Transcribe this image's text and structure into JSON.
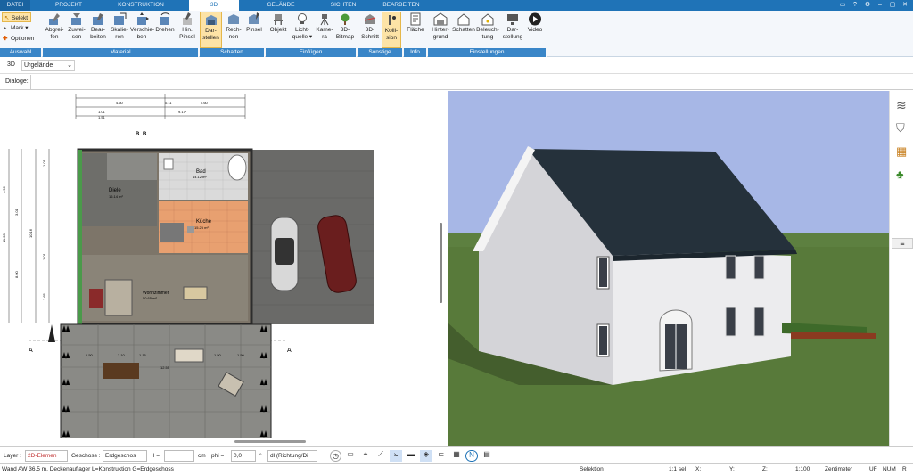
{
  "menu": {
    "tabs": [
      {
        "label": "DATEI"
      },
      {
        "label": "PROJEKT"
      },
      {
        "label": "KONSTRUKTION"
      },
      {
        "label": "3D"
      },
      {
        "label": "GELÄNDE"
      },
      {
        "label": "SICHTEN"
      },
      {
        "label": "BEARBEITEN"
      }
    ]
  },
  "ribbon": {
    "auswahl": {
      "selekt": "Selekt",
      "mark": "Mark",
      "optionen": "Optionen",
      "group": "Auswahl"
    },
    "material": {
      "buttons": [
        {
          "line1": "Abgrei-",
          "line2": "fen"
        },
        {
          "line1": "Zuwei-",
          "line2": "sen"
        },
        {
          "line1": "Bear-",
          "line2": "beiten"
        },
        {
          "line1": "Skalie-",
          "line2": "ren"
        },
        {
          "line1": "Verschie-",
          "line2": "ben"
        },
        {
          "line1": "Drehen",
          "line2": ""
        },
        {
          "line1": "Hin.",
          "line2": "Pinsel"
        }
      ],
      "group": "Material"
    },
    "schatten": {
      "buttons": [
        {
          "line1": "Dar-",
          "line2": "stellen"
        },
        {
          "line1": "Rech-",
          "line2": "nen"
        },
        {
          "line1": "Pinsel",
          "line2": ""
        }
      ],
      "group": "Schatten"
    },
    "einfuegen": {
      "buttons": [
        {
          "line1": "Objekt",
          "line2": ""
        },
        {
          "line1": "Licht-",
          "line2": "quelle ▾"
        },
        {
          "line1": "Kame-",
          "line2": "ra"
        },
        {
          "line1": "3D-",
          "line2": "Bitmap"
        }
      ],
      "group": "Einfügen"
    },
    "sonstige": {
      "buttons": [
        {
          "line1": "3D-",
          "line2": "Schnitt"
        },
        {
          "line1": "Kolli-",
          "line2": "sion"
        }
      ],
      "group": "Sonstige"
    },
    "info": {
      "buttons": [
        {
          "line1": "Fläche",
          "line2": ""
        }
      ],
      "group": "Info"
    },
    "einstellungen": {
      "buttons": [
        {
          "line1": "Hinter-",
          "line2": "grund"
        },
        {
          "line1": "Schatten",
          "line2": ""
        },
        {
          "line1": "Beleuch-",
          "line2": "tung"
        },
        {
          "line1": "Dar-",
          "line2": "stellung"
        },
        {
          "line1": "Video",
          "line2": ""
        }
      ],
      "group": "Einstellungen"
    }
  },
  "bar2": {
    "mode": "3D",
    "terrain": "Urgelände"
  },
  "bar3": {
    "dialoge": "Dialoge:"
  },
  "plan": {
    "dims_top": [
      "4.60",
      "0.11",
      "5.60",
      "1.01",
      "1.51",
      "9.17²"
    ],
    "dims_left": [
      "4.96",
      "3.01",
      "11.03",
      "10.16",
      "8.00",
      "1.01",
      "1.01",
      "1.65"
    ],
    "rooms": [
      {
        "name": "Diele",
        "area": "16.14 m²"
      },
      {
        "name": "Bad",
        "area": "14.12 m²"
      },
      {
        "name": "Küche",
        "area": "15.25 m²"
      },
      {
        "name": "Wohnzimmer",
        "area": "50.65 m²"
      }
    ],
    "terrace_dims": [
      "1.50",
      "2.10",
      "1.16",
      "12.55",
      "1.50",
      "1.50"
    ],
    "section_labels": [
      "A",
      "A",
      "B",
      "B"
    ]
  },
  "colors": {
    "accent": "#1f73b7",
    "ribbon_group": "#3a86c8",
    "selected": "#fde3a6",
    "sky": "#a7b7e6",
    "grass": "#587a3a",
    "roof": "#25313b"
  },
  "bottom_toolbar": {
    "layer_label": "Layer :",
    "layer_value": "2D-Elemen",
    "geschoss_label": "Geschoss :",
    "geschoss_value": "Erdgeschos",
    "l_label": "l =",
    "l_value": "",
    "cm": "cm",
    "phi_label": "phi =",
    "phi_value": "0,0",
    "deg": "°",
    "direction": "dl (Richtung/Di"
  },
  "status": {
    "hint": "Wand AW 36,5 m, Deckenauflager L=Konstruktion G=Erdgeschoss",
    "mode": "Selektion",
    "sel": "1:1 sel",
    "x": "X:",
    "y": "Y:",
    "z": "Z:",
    "scale": "1:100",
    "unit": "Zentimeter",
    "uf": "UF",
    "num": "NUM",
    "r": "R"
  }
}
